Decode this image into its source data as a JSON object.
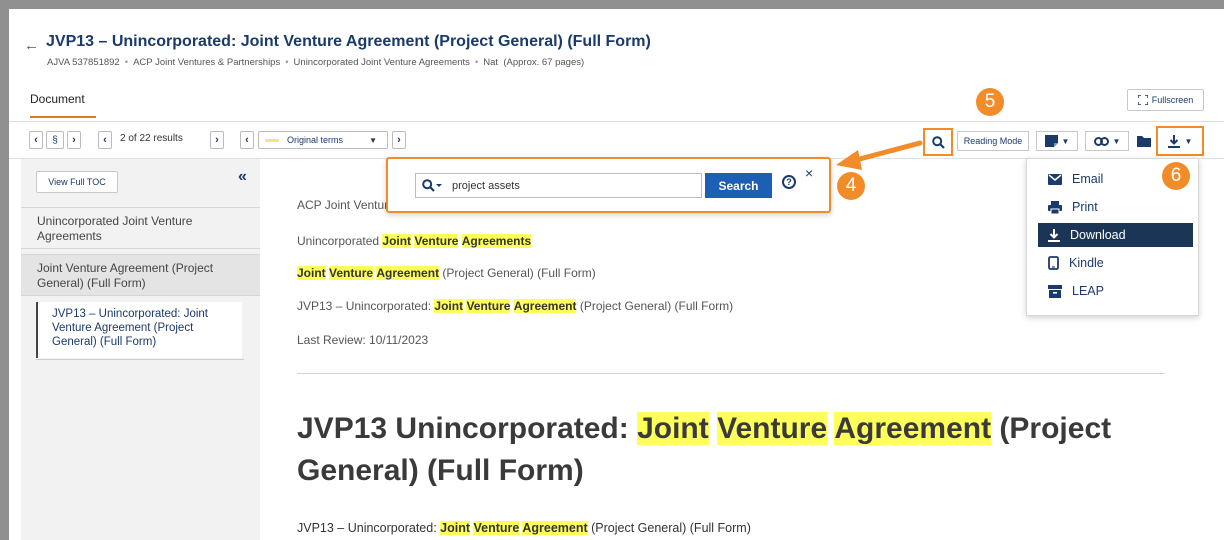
{
  "header": {
    "back_arrow": "←",
    "title": "JVP13 – Unincorporated: Joint Venture Agreement (Project General) (Full Form)",
    "meta": [
      "AJVA 537851892",
      "ACP Joint Ventures & Partnerships",
      "Unincorporated Joint Venture Agreements",
      "Nat",
      "(Approx. 67 pages)"
    ],
    "meta_separator": "•"
  },
  "tabs": {
    "document": "Document",
    "fullscreen": "Fullscreen"
  },
  "toolbar": {
    "section_symbol": "§",
    "results": "2 of 22 results",
    "original_terms": "Original terms",
    "reading_mode": "Reading Mode"
  },
  "search_popup": {
    "query": "project assets",
    "search_label": "Search",
    "help_glyph": "?",
    "close_glyph": "×"
  },
  "sidebar": {
    "view_full_toc": "View Full TOC",
    "collapse_glyph": "«",
    "items": [
      "Unincorporated Joint Venture Agreements",
      "Joint Venture Agreement (Project General) (Full Form)",
      "JVP13 – Unincorporated: Joint Venture Agreement (Project General) (Full Form)"
    ]
  },
  "content": {
    "line1_visible": "ACP Joint Venture",
    "line2": {
      "prefix": "Unincorporated ",
      "h1": "Joint",
      "h2": "Venture",
      "h3": "Agreements"
    },
    "line3": {
      "h1": "Joint",
      "h2": "Venture",
      "h3": "Agreement",
      "suffix": " (Project General) (Full Form)"
    },
    "line4": {
      "prefix": "JVP13 – Unincorporated: ",
      "h1": "Joint",
      "h2": "Venture",
      "h3": "Agreement",
      "suffix": " (Project General) (Full Form)"
    },
    "last_review": "Last Review: 10/11/2023",
    "big_title": {
      "prefix": "JVP13 Unincorporated: ",
      "h1": "Joint",
      "h2": "Venture",
      "h3": "Agreement",
      "suffix": " (Project General) (Full Form)"
    },
    "bottom_line": {
      "prefix": "JVP13 – Unincorporated: ",
      "h1": "Joint",
      "h2": "Venture",
      "h3": "Agreement",
      "suffix": " (Project General) (Full Form)"
    }
  },
  "download_menu": {
    "items": [
      "Email",
      "Print",
      "Download",
      "Kindle",
      "LEAP"
    ],
    "active": "Download"
  },
  "callouts": [
    "4",
    "5",
    "6"
  ],
  "colors": {
    "accent_orange": "#f28c28",
    "navy": "#1a3a6b",
    "highlight": "#ffff5a",
    "search_button": "#1d5fb5"
  }
}
